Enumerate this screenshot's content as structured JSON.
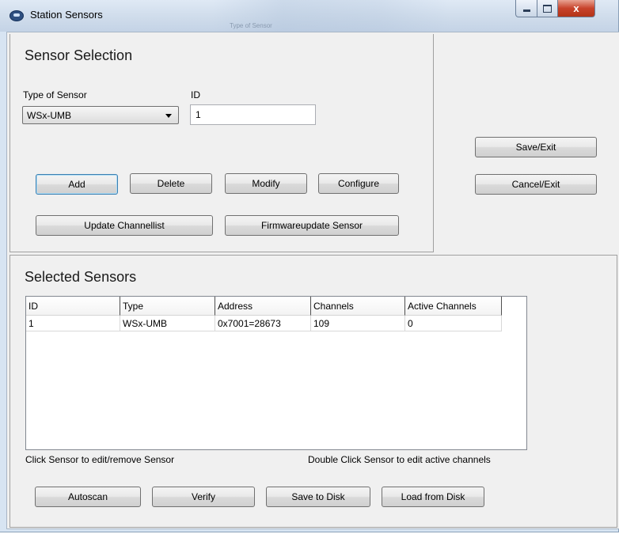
{
  "window": {
    "title": "Station Sensors",
    "close_glyph": "x",
    "background_ghost_text": "Type of Sensor"
  },
  "sensor_selection": {
    "title": "Sensor Selection",
    "type_label": "Type of Sensor",
    "type_value": "WSx-UMB",
    "id_label": "ID",
    "id_value": "1",
    "buttons": {
      "add": "Add",
      "delete": "Delete",
      "modify": "Modify",
      "configure": "Configure",
      "update_channellist": "Update Channellist",
      "firmwareupdate": "Firmwareupdate Sensor"
    }
  },
  "right_buttons": {
    "save_exit": "Save/Exit",
    "cancel_exit": "Cancel/Exit"
  },
  "selected_sensors": {
    "title": "Selected Sensors",
    "columns": [
      "ID",
      "Type",
      "Address",
      "Channels",
      "Active Channels"
    ],
    "rows": [
      [
        "1",
        "WSx-UMB",
        "0x7001=28673",
        "109",
        "0"
      ]
    ],
    "hint_left": "Click Sensor to edit/remove Sensor",
    "hint_right": "Double Click Sensor to edit active channels",
    "buttons": {
      "autoscan": "Autoscan",
      "verify": "Verify",
      "save_to_disk": "Save to Disk",
      "load_from_disk": "Load from Disk"
    }
  },
  "icons": {
    "app": "app-icon",
    "minimize": "minimize-icon",
    "maximize": "maximize-icon",
    "close": "close-icon",
    "dropdown": "chevron-down-icon"
  },
  "colors": {
    "titlebar": "#cfdceb",
    "close_button": "#c8432b",
    "panel": "#f0f0f0",
    "default_button_border": "#3c7fb1"
  }
}
